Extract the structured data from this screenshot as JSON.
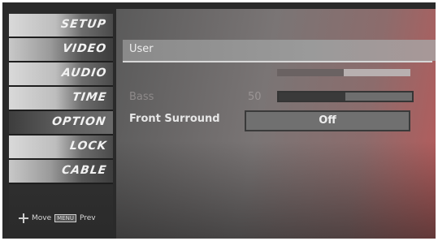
{
  "sidebar": {
    "items": [
      {
        "label": "SETUP",
        "icon": "satellite-icon"
      },
      {
        "label": "VIDEO",
        "icon": "film-icon"
      },
      {
        "label": "AUDIO",
        "icon": "speaker-icon"
      },
      {
        "label": "TIME",
        "icon": "clock-icon"
      },
      {
        "label": "OPTION",
        "icon": "option-icon"
      },
      {
        "label": "LOCK",
        "icon": "lock-icon"
      },
      {
        "label": "CABLE",
        "icon": "cable-icon"
      }
    ],
    "active_index": 4,
    "footer": {
      "move_label": "Move",
      "menu_key": "MENU",
      "prev_label": "Prev"
    }
  },
  "main": {
    "user_label": "User",
    "top_slider_level": 0.5,
    "bass": {
      "label": "Bass",
      "value": "50",
      "level": 0.5
    },
    "front_surround": {
      "label": "Front Surround",
      "value": "Off"
    }
  },
  "colors": {
    "accent": "#b85a5a",
    "panel": "#7a7575",
    "text": "#eeeeee"
  }
}
